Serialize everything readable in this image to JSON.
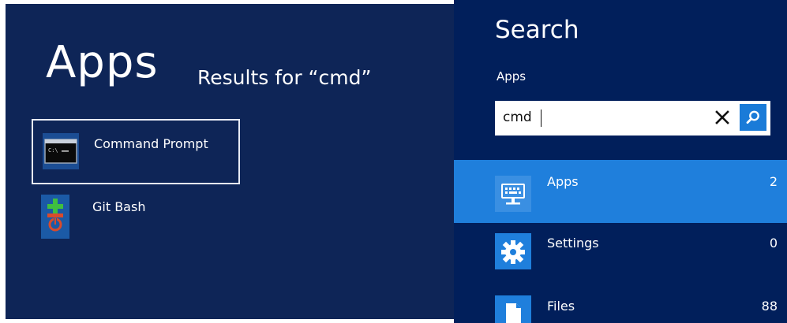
{
  "results": {
    "heading": "Apps",
    "subheading": "Results for “cmd”",
    "apps": [
      {
        "label": "Command Prompt",
        "icon": "command-prompt-icon",
        "selected": true
      },
      {
        "label": "Git Bash",
        "icon": "git-bash-icon",
        "selected": false
      }
    ]
  },
  "search": {
    "title": "Search",
    "scope": "Apps",
    "query": "cmd",
    "clear_icon": "close-icon",
    "submit_icon": "search-icon"
  },
  "scopes": [
    {
      "name": "Apps",
      "count": "2",
      "icon": "keyboard-icon",
      "active": true
    },
    {
      "name": "Settings",
      "count": "0",
      "icon": "gear-icon",
      "active": false
    },
    {
      "name": "Files",
      "count": "88",
      "icon": "file-icon",
      "active": false
    }
  ],
  "colors": {
    "results_background": "#0e2557",
    "search_background": "#011f5b",
    "accent": "#1f7fdc",
    "text": "#ffffff"
  }
}
